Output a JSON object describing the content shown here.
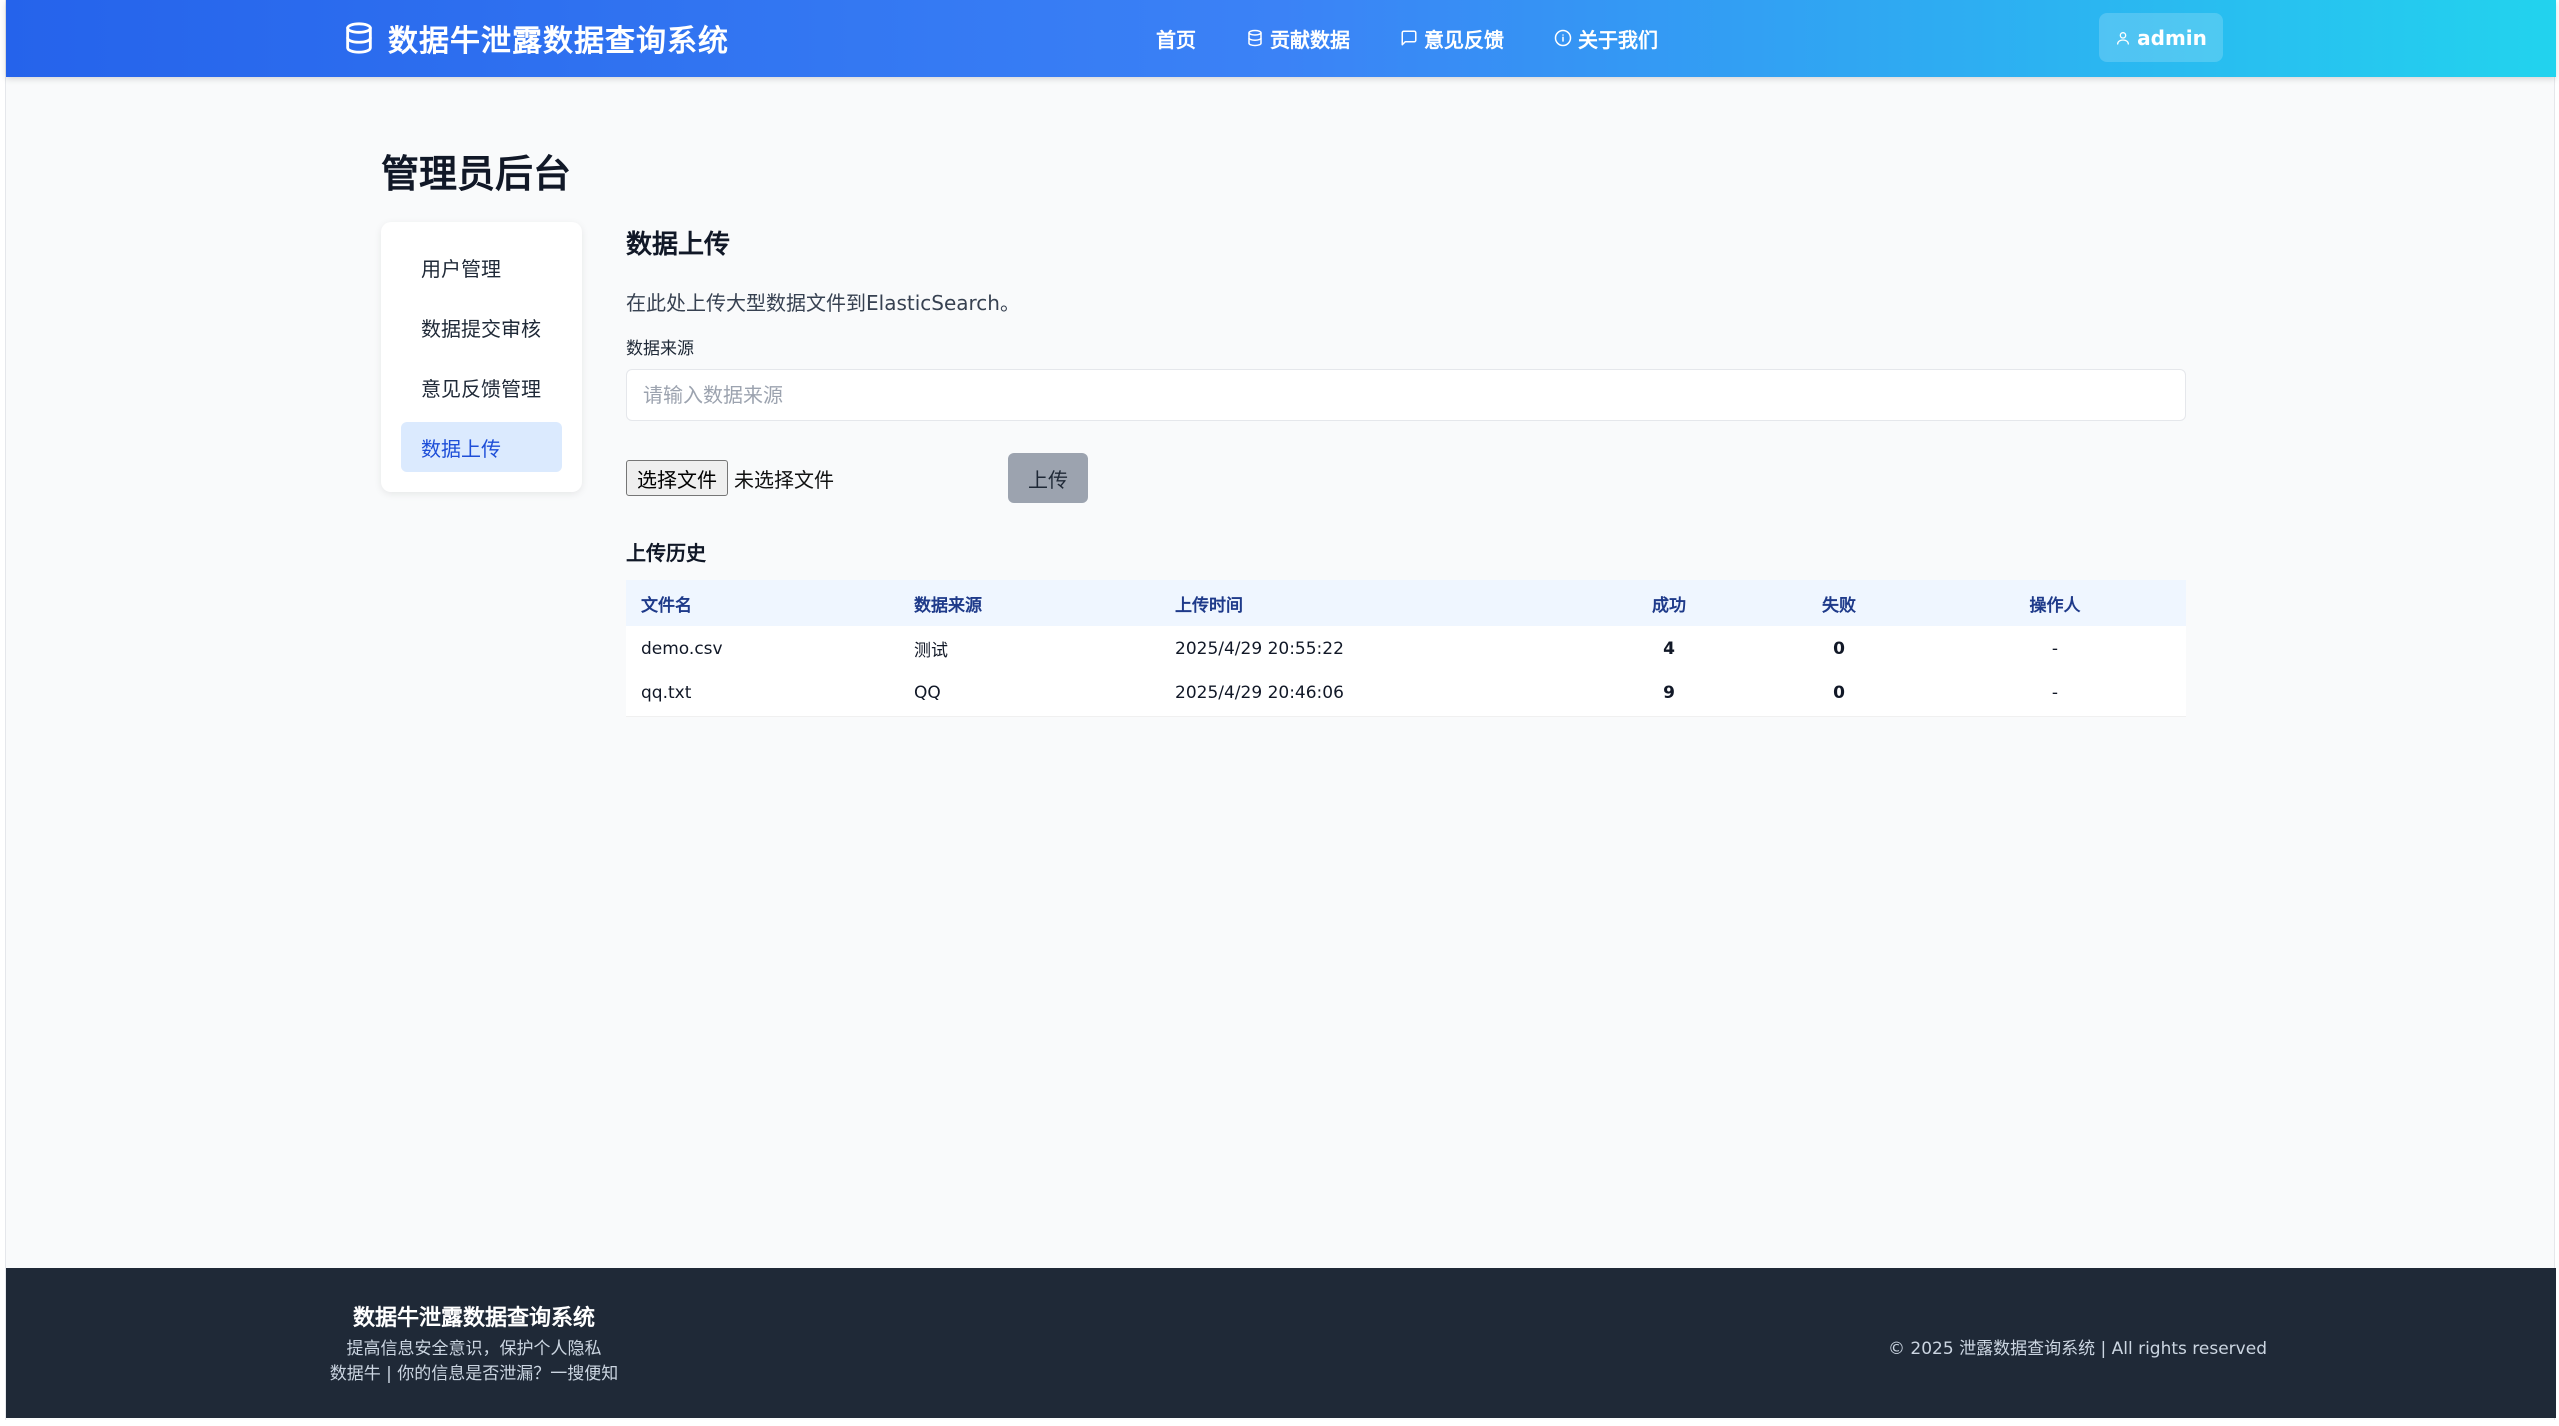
{
  "header": {
    "brand_title": "数据牛泄露数据查询系统",
    "nav": [
      {
        "label": "首页"
      },
      {
        "label": "贡献数据",
        "icon": "database-icon"
      },
      {
        "label": "意见反馈",
        "icon": "chat-icon"
      },
      {
        "label": "关于我们",
        "icon": "info-icon"
      }
    ],
    "user": "admin"
  },
  "page": {
    "title": "管理员后台"
  },
  "sidebar": {
    "items": [
      {
        "label": "用户管理",
        "active": false
      },
      {
        "label": "数据提交审核",
        "active": false
      },
      {
        "label": "意见反馈管理",
        "active": false
      },
      {
        "label": "数据上传",
        "active": true
      }
    ]
  },
  "upload": {
    "title": "数据上传",
    "description": "在此处上传大型数据文件到ElasticSearch。",
    "source_label": "数据来源",
    "source_placeholder": "请输入数据来源",
    "source_value": "",
    "choose_file_label": "选择文件",
    "no_file_text": "未选择文件",
    "upload_button": "上传"
  },
  "history": {
    "title": "上传历史",
    "columns": [
      "文件名",
      "数据来源",
      "上传时间",
      "成功",
      "失败",
      "操作人"
    ],
    "rows": [
      {
        "file": "demo.csv",
        "source": "测试",
        "time": "2025/4/29 20:55:22",
        "success": "4",
        "failed": "0",
        "operator": "-"
      },
      {
        "file": "qq.txt",
        "source": "QQ",
        "time": "2025/4/29 20:46:06",
        "success": "9",
        "failed": "0",
        "operator": "-"
      }
    ]
  },
  "footer": {
    "title": "数据牛泄露数据查询系统",
    "tagline": "提高信息安全意识，保护个人隐私",
    "slogan": "数据牛 | 你的信息是否泄漏？一搜便知",
    "copyright": "© 2025 泄露数据查询系统 | All rights reserved"
  },
  "colors": {
    "header_gradient_start": "#2563eb",
    "header_gradient_end": "#22d3ee",
    "active_item_bg": "#dbeafe",
    "success": "#16a34a",
    "fail": "#dc2626",
    "footer_bg": "#1f2937"
  }
}
